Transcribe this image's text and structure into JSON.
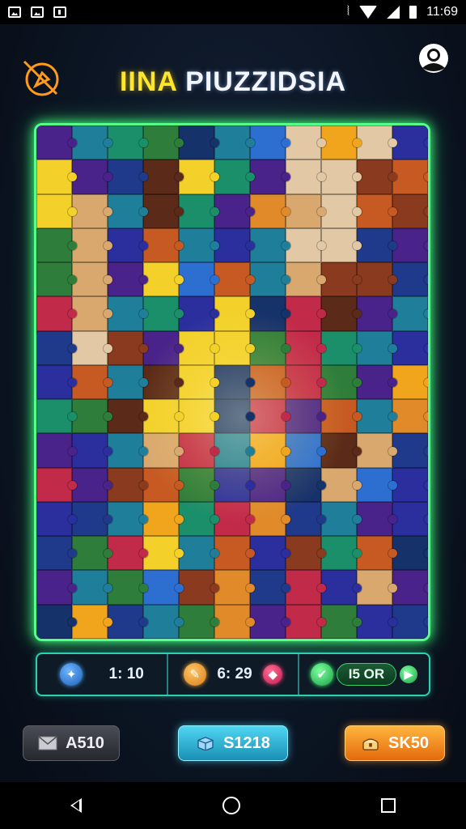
{
  "status_bar": {
    "time": "11:69",
    "left_icons": [
      "gallery-icon",
      "photo-icon",
      "notification-icon"
    ],
    "right_icons": [
      "vibrate-icon",
      "wifi-icon",
      "signal-icon",
      "battery-icon"
    ]
  },
  "header": {
    "title_part1": "IINA",
    "title_part2": "PIUZZIDSIA",
    "left_button_icon": "no-compass-icon",
    "right_button_icon": "profile-icon"
  },
  "board": {
    "columns": 11,
    "rows": 15,
    "colors": [
      "#1f3a8a",
      "#2b2f9e",
      "#4a238a",
      "#1f7e9a",
      "#1a8f6a",
      "#2e7d3a",
      "#c65a22",
      "#e08a2a",
      "#d9a86e",
      "#e2c8a4",
      "#8a3a1e",
      "#5b2a18",
      "#c22a4a",
      "#f3d12a",
      "#f0a51c",
      "#2c6fd1",
      "#16326b"
    ],
    "pattern": [
      [
        2,
        3,
        4,
        5,
        16,
        3,
        15,
        9,
        14,
        9,
        1
      ],
      [
        13,
        2,
        0,
        11,
        13,
        4,
        2,
        9,
        9,
        10,
        6
      ],
      [
        13,
        8,
        3,
        11,
        4,
        2,
        7,
        8,
        9,
        6,
        10
      ],
      [
        5,
        8,
        1,
        6,
        3,
        1,
        3,
        9,
        9,
        0,
        2
      ],
      [
        5,
        8,
        2,
        13,
        15,
        6,
        3,
        8,
        10,
        10,
        0
      ],
      [
        12,
        8,
        3,
        4,
        1,
        13,
        16,
        12,
        11,
        2,
        3
      ],
      [
        0,
        9,
        10,
        2,
        13,
        13,
        5,
        12,
        4,
        3,
        1
      ],
      [
        1,
        6,
        3,
        11,
        13,
        16,
        6,
        12,
        5,
        2,
        14
      ],
      [
        4,
        5,
        11,
        13,
        13,
        16,
        12,
        2,
        6,
        3,
        7
      ],
      [
        2,
        1,
        3,
        8,
        12,
        3,
        14,
        15,
        11,
        8,
        0
      ],
      [
        12,
        2,
        10,
        6,
        5,
        1,
        2,
        16,
        8,
        15,
        1
      ],
      [
        1,
        0,
        3,
        14,
        4,
        12,
        7,
        0,
        3,
        2,
        1
      ],
      [
        0,
        5,
        12,
        13,
        3,
        6,
        1,
        10,
        4,
        6,
        16
      ],
      [
        2,
        3,
        5,
        15,
        10,
        7,
        0,
        12,
        1,
        8,
        2
      ],
      [
        16,
        14,
        0,
        3,
        5,
        7,
        2,
        12,
        5,
        1,
        0
      ]
    ]
  },
  "stats": [
    {
      "icon": "compass-icon",
      "value": "1: 10"
    },
    {
      "icon": "pencil-icon",
      "value": "6: 29",
      "extra_icon": "gem-icon"
    },
    {
      "icon": "check-icon",
      "value": "I5 OR",
      "extra_icon": "arrow-right-icon"
    }
  ],
  "buttons": {
    "left": {
      "label": "A510",
      "icon": "envelope-icon"
    },
    "middle": {
      "label": "S1218",
      "icon": "box-icon"
    },
    "right": {
      "label": "SK50",
      "icon": "treasure-icon"
    }
  },
  "colors": {
    "board_border": "#56ff8a",
    "stats_border": "#2fd0b0",
    "title_yellow": "#ffe52e",
    "middle_button": "#1a8fb4",
    "right_button": "#e46a0c"
  }
}
